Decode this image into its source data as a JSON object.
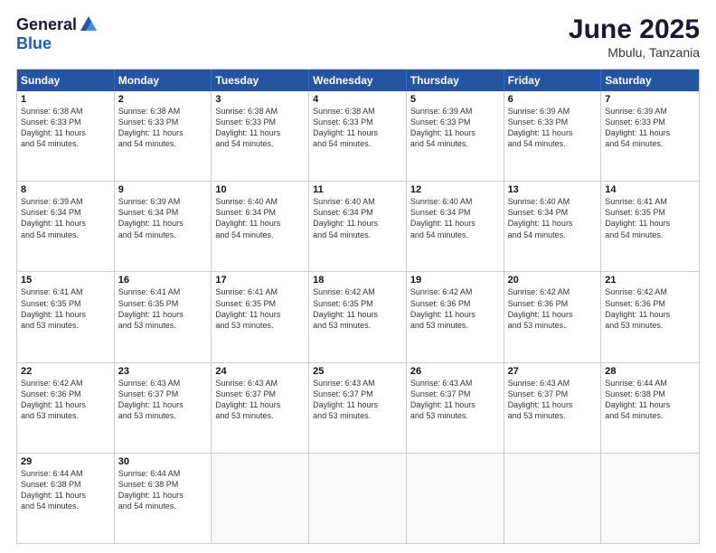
{
  "logo": {
    "general": "General",
    "blue": "Blue"
  },
  "title": {
    "month": "June 2025",
    "location": "Mbulu, Tanzania"
  },
  "header": {
    "days": [
      "Sunday",
      "Monday",
      "Tuesday",
      "Wednesday",
      "Thursday",
      "Friday",
      "Saturday"
    ]
  },
  "weeks": [
    [
      {
        "day": "1",
        "info": "Sunrise: 6:38 AM\nSunset: 6:33 PM\nDaylight: 11 hours\nand 54 minutes."
      },
      {
        "day": "2",
        "info": "Sunrise: 6:38 AM\nSunset: 6:33 PM\nDaylight: 11 hours\nand 54 minutes."
      },
      {
        "day": "3",
        "info": "Sunrise: 6:38 AM\nSunset: 6:33 PM\nDaylight: 11 hours\nand 54 minutes."
      },
      {
        "day": "4",
        "info": "Sunrise: 6:38 AM\nSunset: 6:33 PM\nDaylight: 11 hours\nand 54 minutes."
      },
      {
        "day": "5",
        "info": "Sunrise: 6:39 AM\nSunset: 6:33 PM\nDaylight: 11 hours\nand 54 minutes."
      },
      {
        "day": "6",
        "info": "Sunrise: 6:39 AM\nSunset: 6:33 PM\nDaylight: 11 hours\nand 54 minutes."
      },
      {
        "day": "7",
        "info": "Sunrise: 6:39 AM\nSunset: 6:33 PM\nDaylight: 11 hours\nand 54 minutes."
      }
    ],
    [
      {
        "day": "8",
        "info": "Sunrise: 6:39 AM\nSunset: 6:34 PM\nDaylight: 11 hours\nand 54 minutes."
      },
      {
        "day": "9",
        "info": "Sunrise: 6:39 AM\nSunset: 6:34 PM\nDaylight: 11 hours\nand 54 minutes."
      },
      {
        "day": "10",
        "info": "Sunrise: 6:40 AM\nSunset: 6:34 PM\nDaylight: 11 hours\nand 54 minutes."
      },
      {
        "day": "11",
        "info": "Sunrise: 6:40 AM\nSunset: 6:34 PM\nDaylight: 11 hours\nand 54 minutes."
      },
      {
        "day": "12",
        "info": "Sunrise: 6:40 AM\nSunset: 6:34 PM\nDaylight: 11 hours\nand 54 minutes."
      },
      {
        "day": "13",
        "info": "Sunrise: 6:40 AM\nSunset: 6:34 PM\nDaylight: 11 hours\nand 54 minutes."
      },
      {
        "day": "14",
        "info": "Sunrise: 6:41 AM\nSunset: 6:35 PM\nDaylight: 11 hours\nand 54 minutes."
      }
    ],
    [
      {
        "day": "15",
        "info": "Sunrise: 6:41 AM\nSunset: 6:35 PM\nDaylight: 11 hours\nand 53 minutes."
      },
      {
        "day": "16",
        "info": "Sunrise: 6:41 AM\nSunset: 6:35 PM\nDaylight: 11 hours\nand 53 minutes."
      },
      {
        "day": "17",
        "info": "Sunrise: 6:41 AM\nSunset: 6:35 PM\nDaylight: 11 hours\nand 53 minutes."
      },
      {
        "day": "18",
        "info": "Sunrise: 6:42 AM\nSunset: 6:35 PM\nDaylight: 11 hours\nand 53 minutes."
      },
      {
        "day": "19",
        "info": "Sunrise: 6:42 AM\nSunset: 6:36 PM\nDaylight: 11 hours\nand 53 minutes."
      },
      {
        "day": "20",
        "info": "Sunrise: 6:42 AM\nSunset: 6:36 PM\nDaylight: 11 hours\nand 53 minutes."
      },
      {
        "day": "21",
        "info": "Sunrise: 6:42 AM\nSunset: 6:36 PM\nDaylight: 11 hours\nand 53 minutes."
      }
    ],
    [
      {
        "day": "22",
        "info": "Sunrise: 6:42 AM\nSunset: 6:36 PM\nDaylight: 11 hours\nand 53 minutes."
      },
      {
        "day": "23",
        "info": "Sunrise: 6:43 AM\nSunset: 6:37 PM\nDaylight: 11 hours\nand 53 minutes."
      },
      {
        "day": "24",
        "info": "Sunrise: 6:43 AM\nSunset: 6:37 PM\nDaylight: 11 hours\nand 53 minutes."
      },
      {
        "day": "25",
        "info": "Sunrise: 6:43 AM\nSunset: 6:37 PM\nDaylight: 11 hours\nand 53 minutes."
      },
      {
        "day": "26",
        "info": "Sunrise: 6:43 AM\nSunset: 6:37 PM\nDaylight: 11 hours\nand 53 minutes."
      },
      {
        "day": "27",
        "info": "Sunrise: 6:43 AM\nSunset: 6:37 PM\nDaylight: 11 hours\nand 53 minutes."
      },
      {
        "day": "28",
        "info": "Sunrise: 6:44 AM\nSunset: 6:38 PM\nDaylight: 11 hours\nand 54 minutes."
      }
    ],
    [
      {
        "day": "29",
        "info": "Sunrise: 6:44 AM\nSunset: 6:38 PM\nDaylight: 11 hours\nand 54 minutes."
      },
      {
        "day": "30",
        "info": "Sunrise: 6:44 AM\nSunset: 6:38 PM\nDaylight: 11 hours\nand 54 minutes."
      },
      {
        "day": "",
        "info": ""
      },
      {
        "day": "",
        "info": ""
      },
      {
        "day": "",
        "info": ""
      },
      {
        "day": "",
        "info": ""
      },
      {
        "day": "",
        "info": ""
      }
    ]
  ]
}
